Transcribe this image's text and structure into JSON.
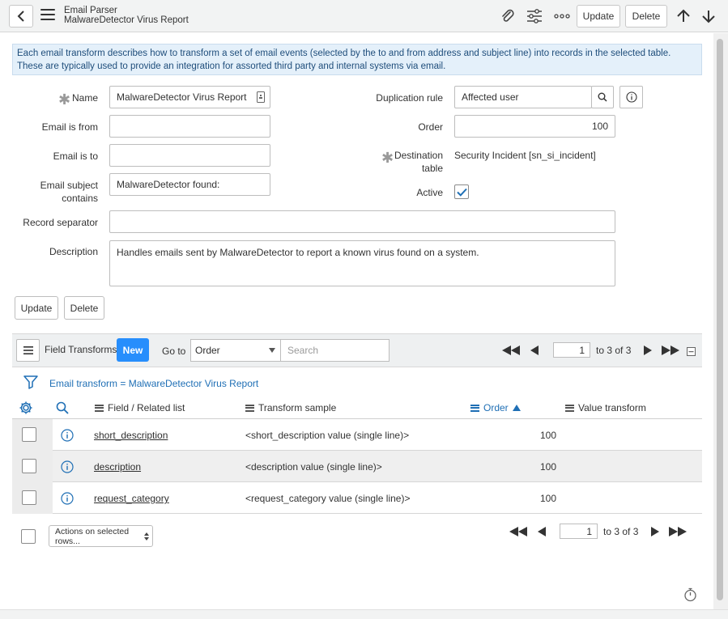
{
  "header": {
    "breadcrumb": "Email Parser",
    "record_title": "MalwareDetector Virus Report",
    "update_label": "Update",
    "delete_label": "Delete",
    "icons": [
      "back-icon",
      "menu-icon",
      "paperclip-icon",
      "sliders-icon",
      "more-icon",
      "arrow-up-icon",
      "arrow-down-icon"
    ]
  },
  "banner": {
    "text": "Each email transform describes how to transform a set of email events (selected by the to and from address and subject line) into records in the selected table. These are typically used to provide an integration for assorted third party and internal systems via email."
  },
  "form": {
    "name": {
      "label": "Name",
      "value": "MalwareDetector Virus Report"
    },
    "email_from": {
      "label": "Email is from",
      "value": ""
    },
    "email_to": {
      "label": "Email is to",
      "value": ""
    },
    "subject": {
      "label_line1": "Email subject",
      "label_line2": "contains",
      "value": "MalwareDetector found:"
    },
    "duplication_rule": {
      "label": "Duplication rule",
      "value": "Affected user"
    },
    "order": {
      "label": "Order",
      "value": "100"
    },
    "destination_table": {
      "label_line1": "Destination",
      "label_line2": "table",
      "value": "Security Incident [sn_si_incident]"
    },
    "active": {
      "label": "Active",
      "checked": true
    },
    "record_separator": {
      "label": "Record separator",
      "value": ""
    },
    "description": {
      "label": "Description",
      "value": "Handles emails sent by MalwareDetector to report a known virus found on a system."
    }
  },
  "form_buttons": {
    "update": "Update",
    "delete": "Delete"
  },
  "related_list": {
    "title": "Field Transforms",
    "new_label": "New",
    "goto_label": "Go to",
    "goto_value": "Order",
    "search_placeholder": "Search",
    "page": "1",
    "page_of": "to 3 of 3",
    "filter": "Email transform = MalwareDetector Virus Report",
    "columns": [
      "Field / Related list",
      "Transform sample",
      "Order",
      "Value transform"
    ],
    "rows": [
      {
        "field": "short_description",
        "sample": "<short_description value (single line)>",
        "order": "100",
        "value_transform": ""
      },
      {
        "field": "description",
        "sample": "<description value (single line)>",
        "order": "100",
        "value_transform": ""
      },
      {
        "field": "request_category",
        "sample": "<request_category value (single line)>",
        "order": "100",
        "value_transform": ""
      }
    ],
    "actions_label": "Actions on selected rows...",
    "footer_page": "1",
    "footer_page_of": "to 3 of 3"
  },
  "colors": {
    "accent": "#278efc",
    "link": "#1f6fb5",
    "banner_bg": "#e4f0fa"
  }
}
